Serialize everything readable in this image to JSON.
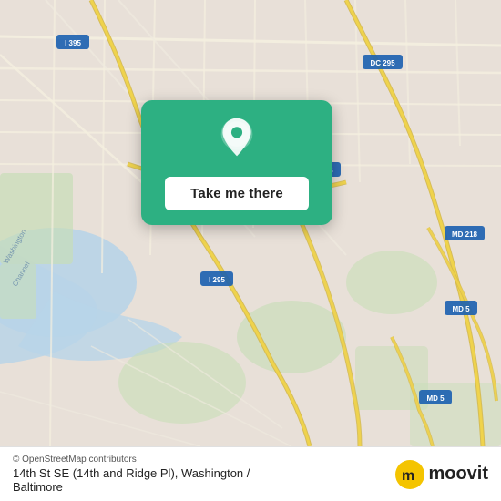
{
  "map": {
    "attribution": "© OpenStreetMap contributors",
    "attribution_link": "OpenStreetMap",
    "background_color": "#e8e0d8"
  },
  "card": {
    "button_label": "Take me there",
    "pin_color": "#2db082"
  },
  "bottom_bar": {
    "osm_credit": "© OpenStreetMap contributors",
    "location_name": "14th St SE (14th and Ridge Pl), Washington /",
    "location_name2": "Baltimore",
    "moovit_label": "moovit"
  }
}
